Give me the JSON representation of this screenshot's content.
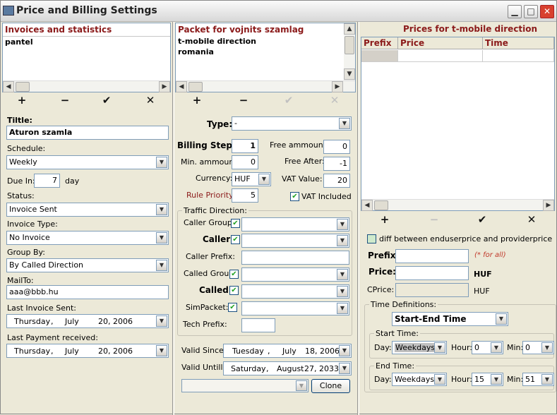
{
  "window": {
    "title": "Price and Billing Settings",
    "min": "▁",
    "max": "□",
    "close": "✕"
  },
  "left": {
    "list_header": "Invoices and statistics",
    "list_items": [
      "pantel"
    ],
    "toolbar": {
      "add": "+",
      "remove": "−",
      "apply": "✔",
      "cancel": "✕"
    },
    "title_label": "Tiltle:",
    "title_value": "Aturon szamla",
    "schedule_label": "Schedule:",
    "schedule_value": "Weekly",
    "due_label": "Due In:",
    "due_value": "7",
    "due_unit": "day",
    "status_label": "Status:",
    "status_value": "Invoice Sent",
    "invoice_type_label": "Invoice Type:",
    "invoice_type_value": "No Invoice",
    "group_by_label": "Group By:",
    "group_by_value": "By Called Direction",
    "mailto_label": "MailTo:",
    "mailto_value": "aaa@bbb.hu",
    "last_invoice_label": "Last Invoice Sent:",
    "last_invoice_value": {
      "weekday": "Thursday",
      "month": "July",
      "day": "20, 2006"
    },
    "last_payment_label": "Last Payment received:",
    "last_payment_value": {
      "weekday": "Thursday",
      "month": "July",
      "day": "20, 2006"
    }
  },
  "middle": {
    "list_header": "Packet for vojnits szamlag",
    "list_items": [
      "t-mobile direction",
      "romania"
    ],
    "toolbar": {
      "add": "+",
      "remove": "−",
      "apply": "✔",
      "cancel": "✕"
    },
    "type_label": "Type:",
    "type_value": "-",
    "billing_steps_label": "Billing Steps:",
    "billing_steps_value": "1",
    "min_amount_label": "Min. ammount:",
    "min_amount_value": "0",
    "currency_label": "Currency:",
    "currency_value": "HUF",
    "rule_priority_label": "Rule Priority:",
    "rule_priority_value": "5",
    "free_amount_label": "Free ammount:",
    "free_amount_value": "0",
    "free_after_label": "Free After:",
    "free_after_value": "-1",
    "vat_value_label": "VAT Value:",
    "vat_value_value": "20",
    "vat_included_label": "VAT Included",
    "traffic_group_title": "Traffic Direction:",
    "caller_group_label": "Caller Group:",
    "caller_label": "Caller:",
    "caller_prefix_label": "Caller Prefix:",
    "called_group_label": "Called Group:",
    "called_label": "Called:",
    "simpacket_label": "SimPacket:",
    "tech_prefix_label": "Tech Prefix:",
    "valid_since_label": "Valid Since:",
    "valid_since_value": {
      "weekday": "Tuesday",
      "month": "July",
      "day": "18, 2006"
    },
    "valid_until_label": "Valid Untill:",
    "valid_until_value": {
      "weekday": "Saturday",
      "month": "August",
      "day": "27, 2033"
    },
    "clone_button": "Clone",
    "check_mark": "✔"
  },
  "right": {
    "header": "Prices for t-mobile direction",
    "columns": [
      "Prefix",
      "Price",
      "Time"
    ],
    "toolbar": {
      "add": "+",
      "remove": "−",
      "apply": "✔",
      "cancel": "✕"
    },
    "diff_label": "diff between enduserprice and providerprice",
    "prefix_label": "Prefix:",
    "prefix_hint": "(* for all)",
    "price_label": "Price:",
    "price_unit": "HUF",
    "cprice_label": "CPrice:",
    "cprice_unit": "HUF",
    "time_defs_title": "Time Definitions:",
    "time_mode_value": "Start-End Time",
    "start_time_title": "Start Time:",
    "end_time_title": "End Time:",
    "day_label": "Day:",
    "hour_label": "Hour:",
    "min_label": "Min:",
    "start_day": "Weekdays",
    "start_hour": "0",
    "start_min": "0",
    "end_day": "Weekdays",
    "end_hour": "15",
    "end_min": "51"
  },
  "icons": {
    "dropdown": "▼",
    "left": "◀",
    "right": "▶",
    "up": "▲",
    "down": "▼",
    "grip": "⁞"
  }
}
